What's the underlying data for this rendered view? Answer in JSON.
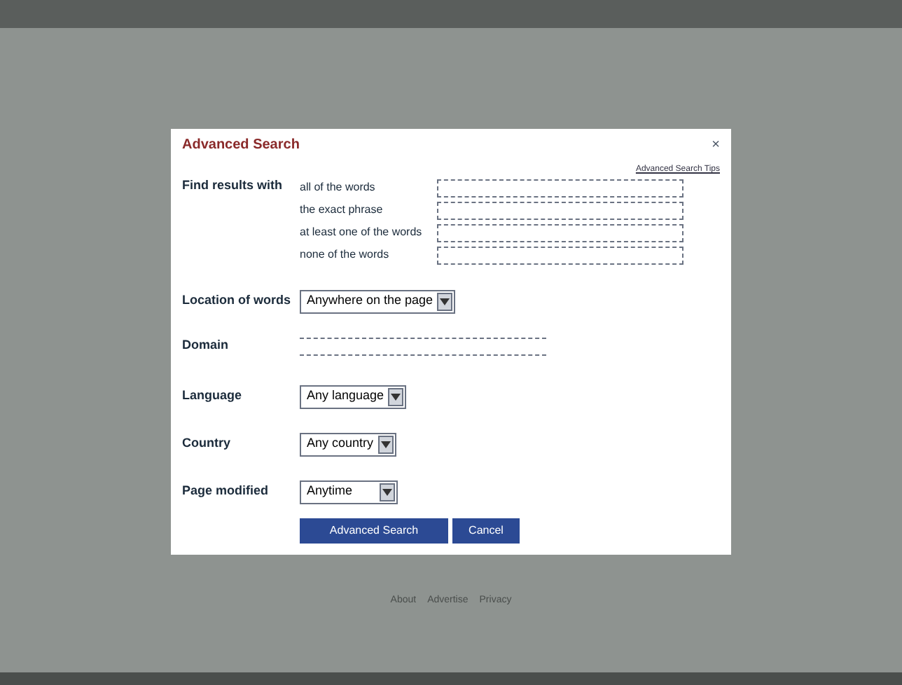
{
  "dialog": {
    "title": "Advanced Search",
    "close": "×",
    "tips_link": "Advanced Search Tips",
    "find_results": {
      "label": "Find results with",
      "fields": [
        {
          "label": "all of the words"
        },
        {
          "label": "the exact phrase"
        },
        {
          "label": "at least one of the words"
        },
        {
          "label": "none of the words"
        }
      ]
    },
    "location": {
      "label": "Location of words",
      "value": "Anywhere on the page"
    },
    "domain": {
      "label": "Domain"
    },
    "language": {
      "label": "Language",
      "value": "Any language"
    },
    "country": {
      "label": "Country",
      "value": "Any country"
    },
    "page_modified": {
      "label": "Page modified",
      "value": "Anytime"
    },
    "buttons": [
      "Advanced Search",
      "Cancel"
    ]
  },
  "footer": {
    "links": [
      "About",
      "Advertise",
      "Privacy"
    ]
  }
}
